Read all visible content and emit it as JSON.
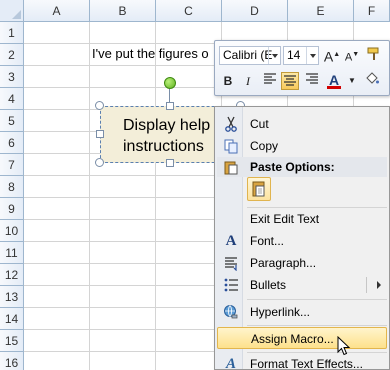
{
  "sheet": {
    "columns": [
      "A",
      "B",
      "C",
      "D",
      "E",
      "F"
    ],
    "rows": [
      "1",
      "2",
      "3",
      "4",
      "5",
      "6",
      "7",
      "8",
      "9",
      "10",
      "11",
      "12",
      "13",
      "14",
      "15",
      "16"
    ],
    "cell_b2_text": "I've put the figures o"
  },
  "shape": {
    "text": "Display help\ninstructions"
  },
  "mini_toolbar": {
    "font_name": "Calibri (E",
    "font_size": "14",
    "grow_font": "A",
    "shrink_font": "A",
    "bold": "B",
    "italic": "I",
    "font_color": "A",
    "font_color_hex": "#d10000"
  },
  "context_menu": {
    "cut": "Cut",
    "copy": "Copy",
    "paste_options": "Paste Options:",
    "exit_edit_text": "Exit Edit Text",
    "font": "Font...",
    "paragraph": "Paragraph...",
    "bullets": "Bullets",
    "hyperlink": "Hyperlink...",
    "assign_macro": "Assign Macro...",
    "format_text_effects": "Format Text Effects..."
  },
  "icons": {
    "cut": "scissors-icon",
    "copy": "copy-icon",
    "paste": "clipboard-icon",
    "font": "font-icon",
    "paragraph": "paragraph-icon",
    "bullets": "bullets-icon",
    "hyperlink": "hyperlink-icon",
    "format_text_effects": "text-effects-icon"
  }
}
